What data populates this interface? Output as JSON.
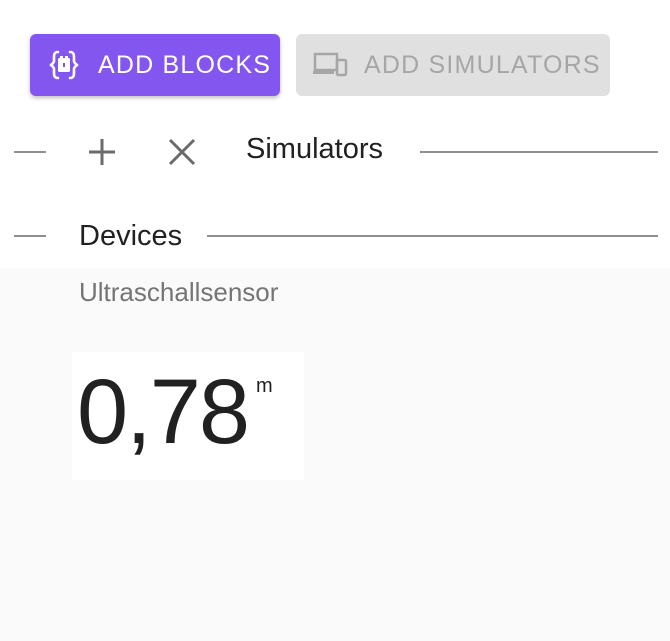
{
  "toolbar": {
    "add_blocks_label": "ADD BLOCKS",
    "add_simulators_label": "ADD SIMULATORS",
    "primary_color": "#8456f0",
    "disabled_color": "#e0e0e0"
  },
  "simulators_section": {
    "title": "Simulators",
    "add_icon": "plus-icon",
    "close_icon": "close-icon"
  },
  "devices_section": {
    "title": "Devices",
    "device": {
      "name": "Ultraschallsensor",
      "value": "0,78",
      "unit": "m"
    }
  }
}
